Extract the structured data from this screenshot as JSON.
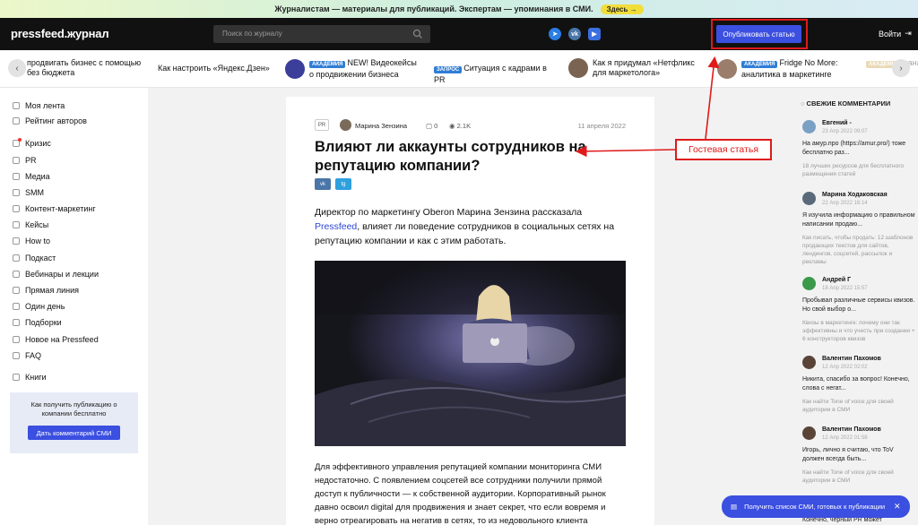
{
  "banner": {
    "text": "Журналистам — материалы для публикаций. Экспертам — упоминания в СМИ.",
    "link": "Здесь →"
  },
  "header": {
    "logo": "pressfeed.журнал",
    "search_placeholder": "Поиск по журналу",
    "social_icons": [
      "telegram-icon",
      "vk-icon",
      "youtube-icon"
    ],
    "publish_label": "Опубликовать статью",
    "login_label": "Войти"
  },
  "ticker": {
    "items": [
      {
        "label": "продвигать бизнес с помощью без бюджета",
        "tag": ""
      },
      {
        "label": "Как настроить «Яндекс.Дзен»",
        "tag": ""
      },
      {
        "label": "NEW! Видеокейсы о продвижении бизнеса",
        "tag": "АКАДЕМИЯ"
      },
      {
        "label": "Ситуация с кадрами в PR",
        "tag": "ЗАПРОС"
      },
      {
        "label": "Как я придумал «Нетфликс для маркетолога»",
        "tag": ""
      },
      {
        "label": "Fridge No More: аналитика в маркетинге",
        "tag": "АКАДЕМИЯ"
      },
      {
        "label": "канал",
        "tag": "АКАДЕМИЯ"
      }
    ]
  },
  "sidebar": {
    "items": [
      {
        "label": "Моя лента"
      },
      {
        "label": "Рейтинг авторов"
      },
      {
        "label": "Кризис"
      },
      {
        "label": "PR"
      },
      {
        "label": "Медиа"
      },
      {
        "label": "SMM"
      },
      {
        "label": "Контент-маркетинг"
      },
      {
        "label": "Кейсы"
      },
      {
        "label": "How to"
      },
      {
        "label": "Подкаст"
      },
      {
        "label": "Вебинары и лекции"
      },
      {
        "label": "Прямая линия"
      },
      {
        "label": "Один день"
      },
      {
        "label": "Подборки"
      },
      {
        "label": "Новое на Pressfeed"
      },
      {
        "label": "FAQ"
      },
      {
        "label": "Книги"
      }
    ],
    "promo": {
      "text": "Как получить публикацию о компании бесплатно",
      "button": "Дать комментарий СМИ"
    }
  },
  "article": {
    "category": "PR",
    "author": "Марина Зензина",
    "comments": "0",
    "views": "2.1K",
    "date": "11 апреля 2022",
    "title": "Влияют ли аккаунты сотрудников на репутацию компании?",
    "share_vk": "vk",
    "share_tg": "tg",
    "lead_before": "Директор по маркетингу Oberon Марина Зензина рассказала ",
    "lead_link": "Pressfeed",
    "lead_after": ", влияет ли поведение сотрудников в социальных сетях на репутацию компании и как с этим работать.",
    "body": "Для эффективного управления репутацией компании мониторинга СМИ недостаточно. С появлением соцсетей все сотрудники получили прямой доступ к публичности — к собственной аудитории. Корпоративный рынок давно освоил digital для продвижения и знает секрет, что если вовремя и верно отреагировать на негатив в сетях, то из недовольного клиента"
  },
  "annotation": {
    "label": "Гостевая статья",
    "color": "#e01a1a"
  },
  "comments_panel": {
    "title": "СВЕЖИЕ КОММЕНТАРИИ",
    "items": [
      {
        "name": "Евгений -",
        "date": "23 Апр 2022 09:07",
        "text": "На амур.про (https://amur.pro/) тоже бесплатно раз...",
        "link": "18 лучших ресурсов для бесплатного размещения статей"
      },
      {
        "name": "Марина Ходаковская",
        "date": "22 Апр 2022 16:14",
        "text": "Я изучила информацию о правильном написании продаю...",
        "link": "Как писать, чтобы продать: 12 шаблонов продающих текстов для сайтов, лендингов, соцсетей, рассылок и рекламы"
      },
      {
        "name": "Андрей Г",
        "date": "18 Апр 2022 15:57",
        "text": "Пробывал различные сервисы квизов. Но свой выбор о...",
        "link": "Квизы в маркетинге: почему они так эффективны и что учесть при создании + 6 конструкторов квизов"
      },
      {
        "name": "Валентин Пахомов",
        "date": "12 Апр 2022 02:02",
        "text": "Никита, спасибо за вопрос! Конечно, слова с негат...",
        "link": "Как найти Tone of voice для своей аудитории в СМИ"
      },
      {
        "name": "Валентин Пахомов",
        "date": "12 Апр 2022 01:58",
        "text": "Игорь, лично я считаю, что ToV должен всегда быть...",
        "link": "Как найти Tone of voice для своей аудитории в СМИ"
      }
    ],
    "cut_text": "Конечно, чёрный PR может"
  },
  "toast": {
    "text": "Получить список СМИ, готовых к публикации"
  },
  "colors": {
    "accent": "#3b4fe0",
    "annotation": "#e01a1a",
    "header": "#111111"
  }
}
